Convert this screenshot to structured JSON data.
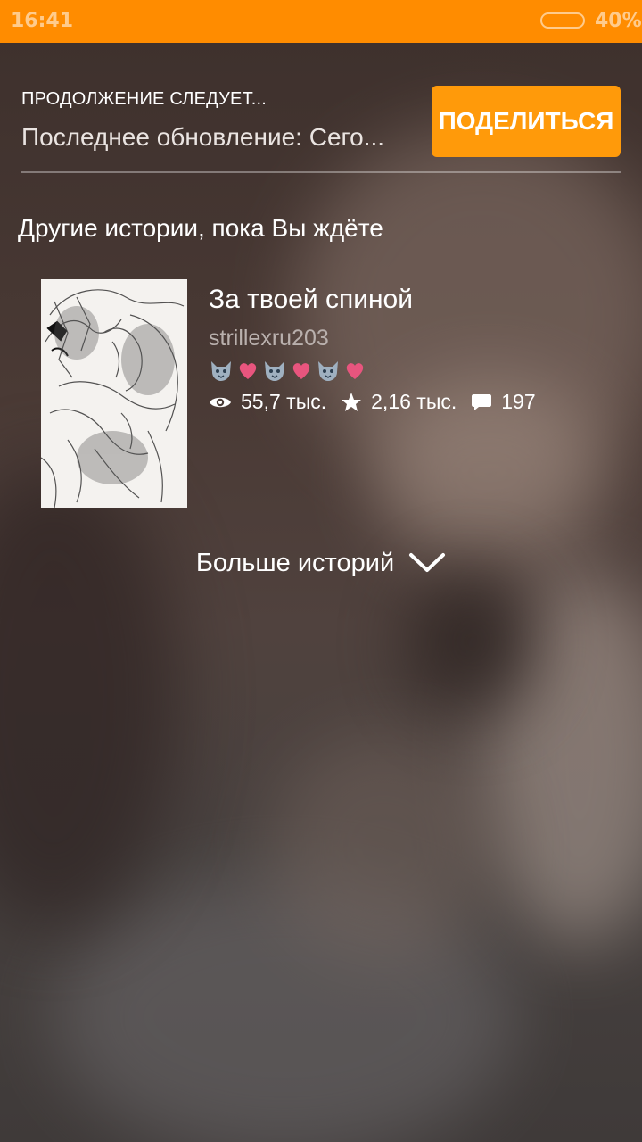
{
  "status_bar": {
    "time": "16:41",
    "battery": "40%"
  },
  "header": {
    "label": "ПРОДОЛЖЕНИЕ СЛЕДУЕТ...",
    "last_update": "Последнее обновление: Сего...",
    "share_label": "ПОДЕЛИТЬСЯ"
  },
  "section": {
    "title": "Другие истории, пока Вы ждёте"
  },
  "story": {
    "title": "За твоей спиной",
    "author": "strillexru203",
    "emoji": [
      "wolf-emoji",
      "heart-emoji",
      "wolf-emoji",
      "heart-emoji",
      "wolf-emoji",
      "heart-emoji"
    ],
    "reads": "55,7 тыс.",
    "votes": "2,16 тыс.",
    "comments": "197"
  },
  "more": {
    "label": "Больше историй"
  },
  "colors": {
    "accent": "#ff8c00",
    "button": "#ff9a0a",
    "heart": "#e8557e"
  }
}
